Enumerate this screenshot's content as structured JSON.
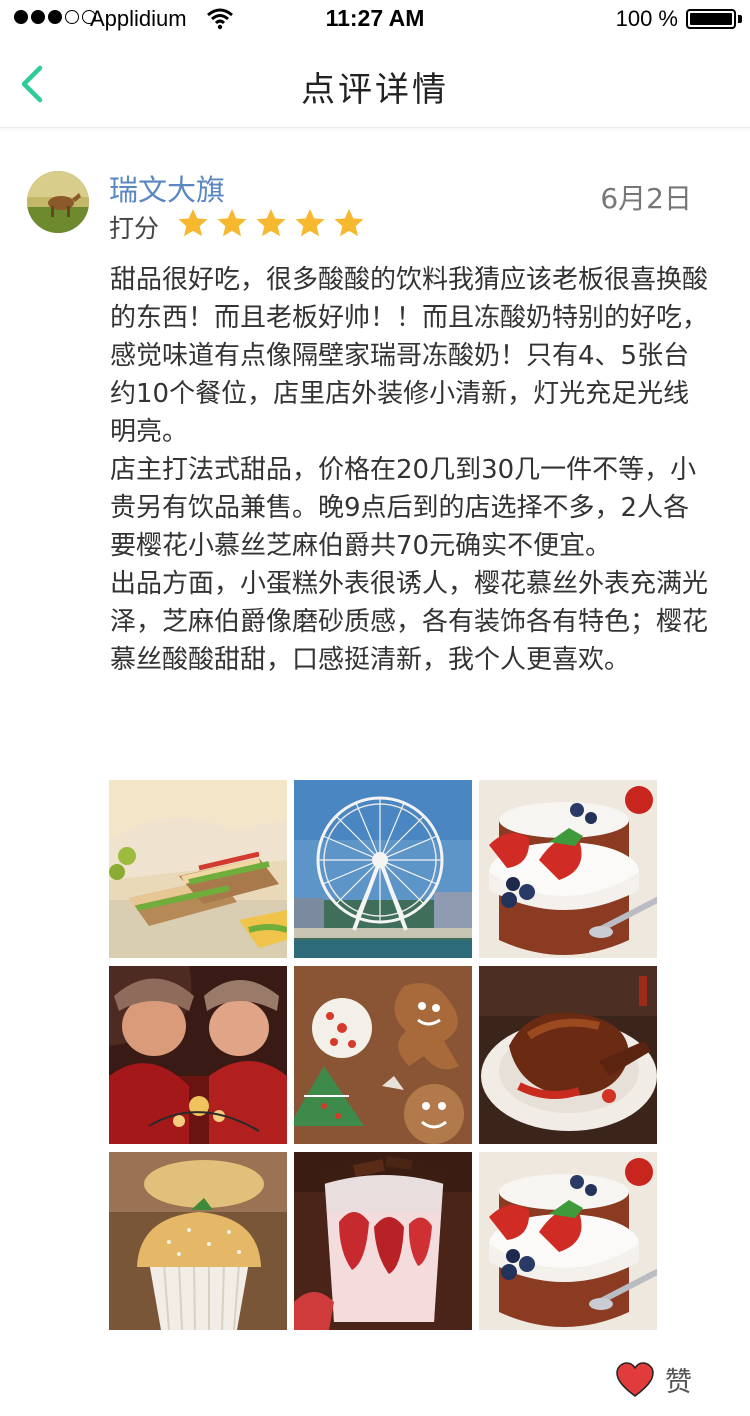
{
  "status_bar": {
    "carrier": "Applidium",
    "time": "11:27 AM",
    "battery_percent": "100 %",
    "signal_bars_filled": 3,
    "signal_bars_total": 5
  },
  "nav": {
    "back_icon": "chevron-left-icon",
    "title": "点评详情",
    "accent_color": "#2ecc9a"
  },
  "review": {
    "username": "瑞文大旗",
    "date": "6月2日",
    "rating_label": "打分",
    "rating": 5,
    "rating_max": 5,
    "star_color": "#f5b82e",
    "paragraphs": [
      "甜品很好吃，很多酸酸的饮料我猜应该老板很喜换酸的东西！而且老板好帅！！而且冻酸奶特别的好吃，感觉味道有点像隔壁家瑞哥冻酸奶！只有4、5张台约10个餐位，店里店外装修小清新，灯光充足光线明亮。",
      "店主打法式甜品，价格在20几到30几一件不等，小贵另有饮品兼售。晚9点后到的店选择不多，2人各要樱花小慕丝芝麻伯爵共70元确实不便宜。",
      "出品方面，小蛋糕外表很诱人，樱花慕丝外表充满光泽，芝麻伯爵像磨砂质感，各有装饰各有特色；樱花慕丝酸酸甜甜，口感挺清新，我个人更喜欢。"
    ],
    "photos": [
      "sandwich-photo",
      "ferris-wheel-photo",
      "berry-yogurt-photo",
      "children-lights-photo",
      "gingerbread-cookies-photo",
      "roast-duck-photo",
      "muffin-photo",
      "strawberry-chocolate-parfait-photo",
      "berry-yogurt-photo"
    ]
  },
  "like": {
    "label": "赞",
    "icon": "heart-icon",
    "color": "#e23b3b"
  }
}
